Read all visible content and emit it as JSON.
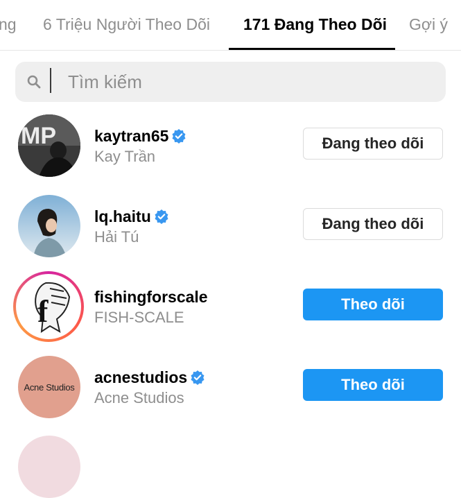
{
  "tabs": [
    {
      "label": "ng"
    },
    {
      "label": "6 Triệu Người Theo Dõi"
    },
    {
      "label": "171 Đang Theo Dõi"
    },
    {
      "label": "Gợi ý"
    }
  ],
  "search": {
    "placeholder": "Tìm kiếm",
    "value": ""
  },
  "users": [
    {
      "username": "kaytran65",
      "full_name": "Kay Trần",
      "verified": true,
      "button": "Đang theo dõi",
      "avatar_text": "MP"
    },
    {
      "username": "lq.haitu",
      "full_name": "Hải Tú",
      "verified": true,
      "button": "Đang theo dõi"
    },
    {
      "username": "fishingforscale",
      "full_name": "FISH-SCALE",
      "verified": false,
      "button": "Theo dõi",
      "avatar_text": "f"
    },
    {
      "username": "acnestudios",
      "full_name": "Acne Studios",
      "verified": true,
      "button": "Theo dõi",
      "avatar_text": "Acne Studios"
    }
  ],
  "colors": {
    "accent": "#1c96f3",
    "verified_badge": "#3897f0",
    "muted": "#8e8e8e",
    "acne_bg": "#e1a08e"
  }
}
